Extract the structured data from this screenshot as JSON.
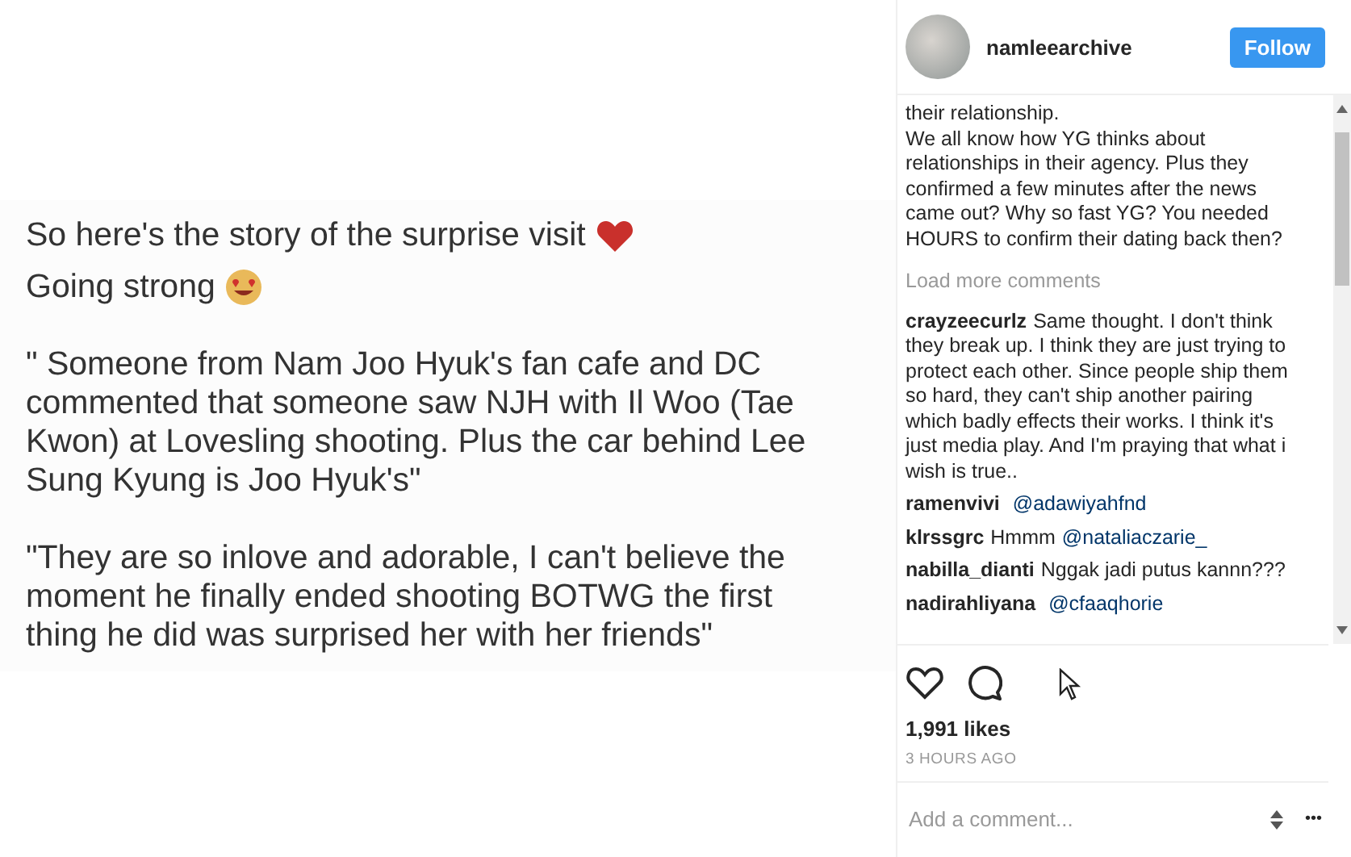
{
  "post_image": {
    "paragraphs": [
      {
        "lines": [
          "So here's the story of the surprise visit",
          "Going strong"
        ]
      },
      {
        "lines": [
          "\" Someone from Nam Joo Hyuk's fan cafe and DC",
          "commented that someone saw NJH with Il Woo (Tae",
          "Kwon) at Lovesling shooting. Plus the car behind Lee",
          "Sung Kyung is Joo Hyuk's\""
        ]
      },
      {
        "lines": [
          "\"They are so inlove and adorable, I can't believe the",
          "moment he finally ended shooting BOTWG the first",
          "thing he did was surprised her with her friends\""
        ]
      }
    ]
  },
  "header": {
    "username": "namleearchive",
    "follow_button": "Follow"
  },
  "caption_tail": "their relationship.\nWe all know how YG thinks about relationships in their agency. Plus they confirmed a few minutes after the news came out? Why so fast YG? You needed HOURS to confirm their dating back then?",
  "load_more": "Load more comments",
  "comments": [
    {
      "user": "crayzeecurlz",
      "text": "Same thought. I don't think they break up. I think they are just trying to protect each other. Since people ship them so hard, they can't ship another pairing which badly effects their works. I think it's just media play. And I'm praying that what i wish is true.."
    },
    {
      "user": "ramenvivi",
      "mention": "@adawiyahfnd"
    },
    {
      "user": "klrssgrc",
      "text": "Hmmm",
      "mention": "@nataliaczarie_"
    },
    {
      "user": "nabilla_dianti",
      "text": "Nggak jadi putus kannn???"
    },
    {
      "user": "nadirahliyana",
      "mention": "@cfaaqhorie"
    }
  ],
  "likes": "1,991 likes",
  "time": "3 HOURS AGO",
  "comment_field": {
    "placeholder": "Add a comment..."
  },
  "more_button": "•••"
}
